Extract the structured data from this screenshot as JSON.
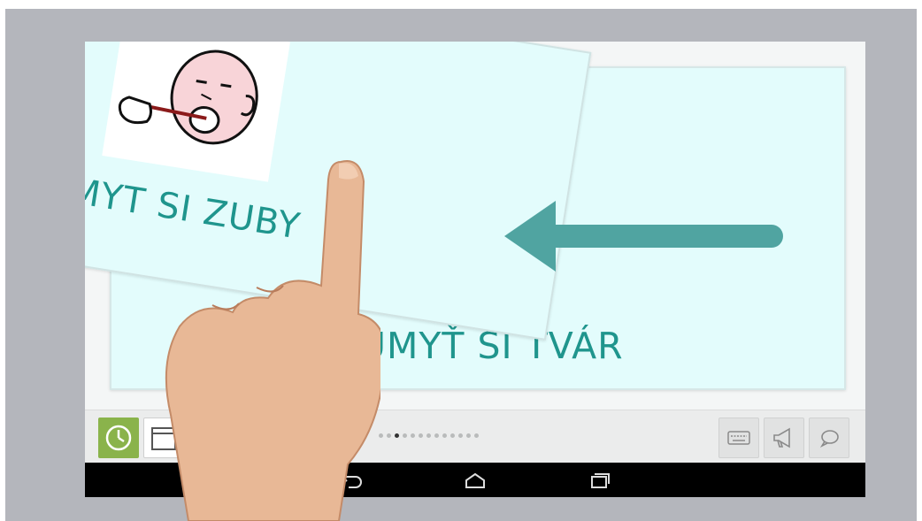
{
  "cards": {
    "back_label": "UMYŤ SI TVÁR",
    "front_label": "UMYT SI ZUBY"
  },
  "toolbar": {
    "page_dots_total": 13,
    "page_dots_active_index": 2
  },
  "colors": {
    "card_fill": "#e3fcfc",
    "label_teal": "#1f958d",
    "arrow_teal": "#50a4a1",
    "clock_green": "#8ab34b"
  },
  "icons": {
    "clock": "clock-icon",
    "calendar": "calendar-icon",
    "keyboard": "keyboard-icon",
    "speaker": "megaphone-icon",
    "chat": "speech-bubble-icon",
    "nav_back": "back-icon",
    "nav_home": "home-icon",
    "nav_recents": "recents-icon"
  }
}
